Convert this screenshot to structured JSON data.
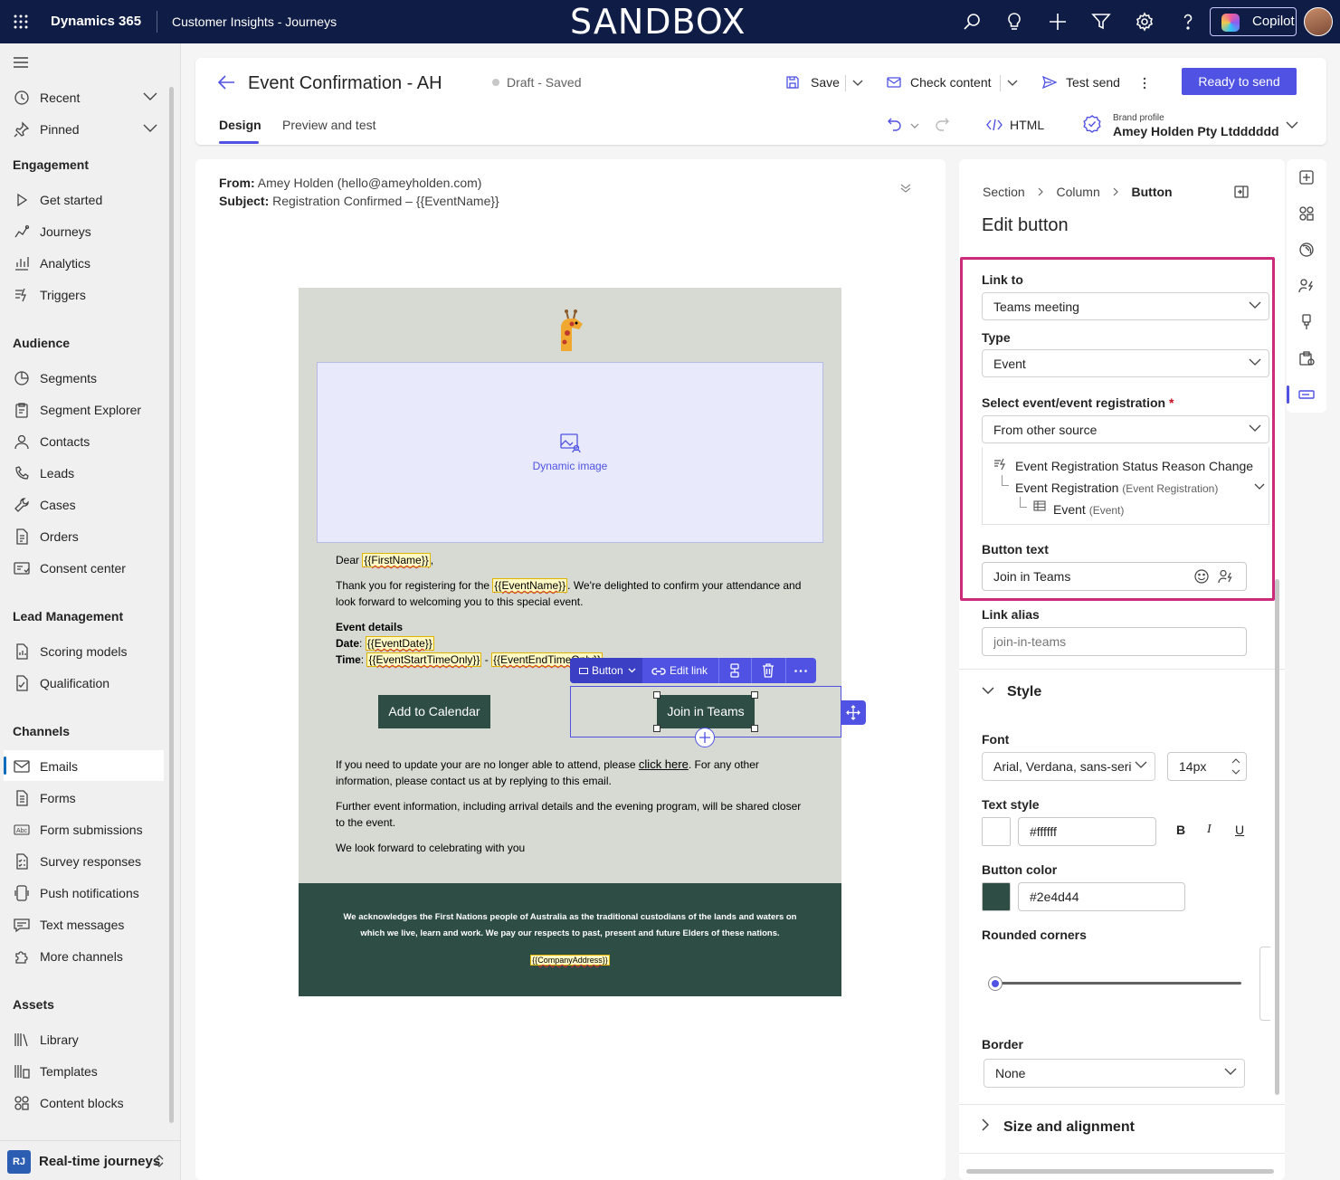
{
  "topbar": {
    "app_name": "Dynamics 365",
    "area_name": "Customer Insights - Journeys",
    "env_label": "SANDBOX",
    "copilot_label": "Copilot"
  },
  "sidebar": {
    "recent": "Recent",
    "pinned": "Pinned",
    "sections": {
      "engagement": "Engagement",
      "audience": "Audience",
      "lead_management": "Lead Management",
      "channels": "Channels",
      "assets": "Assets"
    },
    "engagement": [
      "Get started",
      "Journeys",
      "Analytics",
      "Triggers"
    ],
    "audience": [
      "Segments",
      "Segment Explorer",
      "Contacts",
      "Leads",
      "Cases",
      "Orders",
      "Consent center"
    ],
    "lead_management": [
      "Scoring models",
      "Qualification"
    ],
    "channels": [
      "Emails",
      "Forms",
      "Form submissions",
      "Survey responses",
      "Push notifications",
      "Text messages",
      "More channels"
    ],
    "assets": [
      "Library",
      "Templates",
      "Content blocks"
    ],
    "area_badge": "RJ",
    "area_switcher": "Real-time journeys"
  },
  "header": {
    "title": "Event Confirmation - AH",
    "status": "Draft - Saved",
    "save": "Save",
    "check_content": "Check content",
    "test_send": "Test send",
    "ready": "Ready to send",
    "tabs": [
      "Design",
      "Preview and test"
    ],
    "html": "HTML",
    "brand_profile_label": "Brand profile",
    "brand_profile_value": "Amey Holden Pty Ltdddddd"
  },
  "email_meta": {
    "from_label": "From:",
    "from_value": "Amey Holden (hello@ameyholden.com)",
    "subject_label": "Subject:",
    "subject_value": "Registration Confirmed – {{EventName}}"
  },
  "email": {
    "dynamic_image": "Dynamic image",
    "dear": "Dear ",
    "first_name_token": "{{FirstName}}",
    "comma": ",",
    "thanks_a": "Thank you for registering for the ",
    "event_name_token": "{{EventName}}",
    "thanks_b": ". We're delighted to confirm your attendance and look forward to welcoming you to this special event.",
    "event_details": "Event details",
    "date_label": "Date",
    "date_token": "{{EventDate}}",
    "time_label": "Time",
    "start_token": "{{EventStartTimeOnly}}",
    "dash": " - ",
    "end_token": "{{EventEndTimeOnly}}",
    "add_to_calendar": "Add to Calendar",
    "join_teams": "Join in Teams",
    "update_a": "If you need to update your are no longer able to attend, please ",
    "click_here": "click here",
    "update_b": ". For any other information, please contact us at by replying to this email.",
    "further": "Further event information, including arrival details and the evening program, will be shared closer to the event.",
    "look_forward": "We look forward to celebrating with you",
    "footer_text": "We acknowledges the First Nations people of Australia as the traditional custodians of the lands and waters on which we live, learn and work. We pay our respects to past, present and future Elders of these nations.",
    "company_token": "{{CompanyAddress}}"
  },
  "toolbar": {
    "button_label": "Button",
    "edit_link": "Edit link"
  },
  "panel": {
    "breadcrumb": [
      "Section",
      "Column",
      "Button"
    ],
    "heading": "Edit button",
    "link_to_label": "Link to",
    "link_to_value": "Teams meeting",
    "type_label": "Type",
    "type_value": "Event",
    "select_label": "Select event/event registration",
    "required_mark": "*",
    "select_value": "From other source",
    "tree": {
      "root": "Event Registration Status Reason Change",
      "child": "Event Registration",
      "child_type": "(Event Registration)",
      "leaf": "Event",
      "leaf_type": "(Event)"
    },
    "button_text_label": "Button text",
    "button_text_value": "Join in Teams",
    "link_alias_label": "Link alias",
    "link_alias_placeholder": "join-in-teams",
    "style_label": "Style",
    "font_label": "Font",
    "font_value": "Arial, Verdana, sans-seri",
    "font_size": "14px",
    "text_style_label": "Text style",
    "text_color": "#ffffff",
    "button_color_label": "Button color",
    "button_color": "#2e4d44",
    "rounded_label": "Rounded corners",
    "rounded_value": 0,
    "border_label": "Border",
    "border_value": "None",
    "size_label": "Size and alignment"
  },
  "colors": {
    "topbar": "#0f1c46",
    "accent": "#4f52e2",
    "highlight": "#cc2a7a",
    "email_bg": "#d6dad2",
    "button_green": "#2e4d44"
  }
}
